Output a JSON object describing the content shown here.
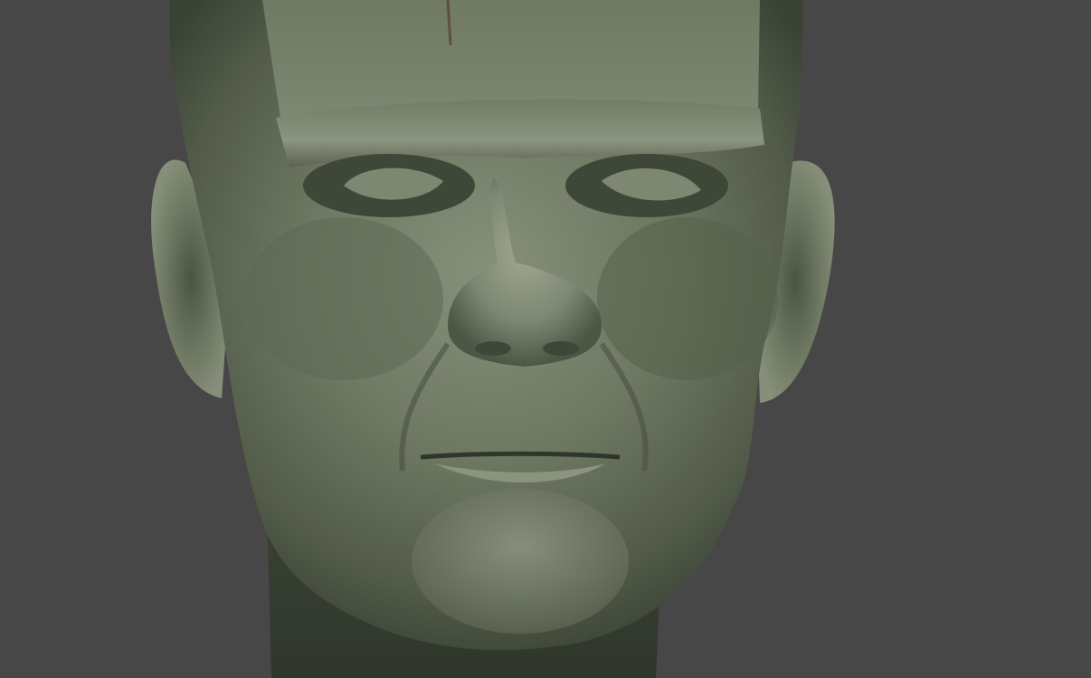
{
  "viewport": {
    "background_color": "#474747",
    "subject": "sculpted-head-render",
    "material_color": "#79836c",
    "material_shadow_color": "#3a4235",
    "material_highlight_color": "#a5ad97"
  }
}
